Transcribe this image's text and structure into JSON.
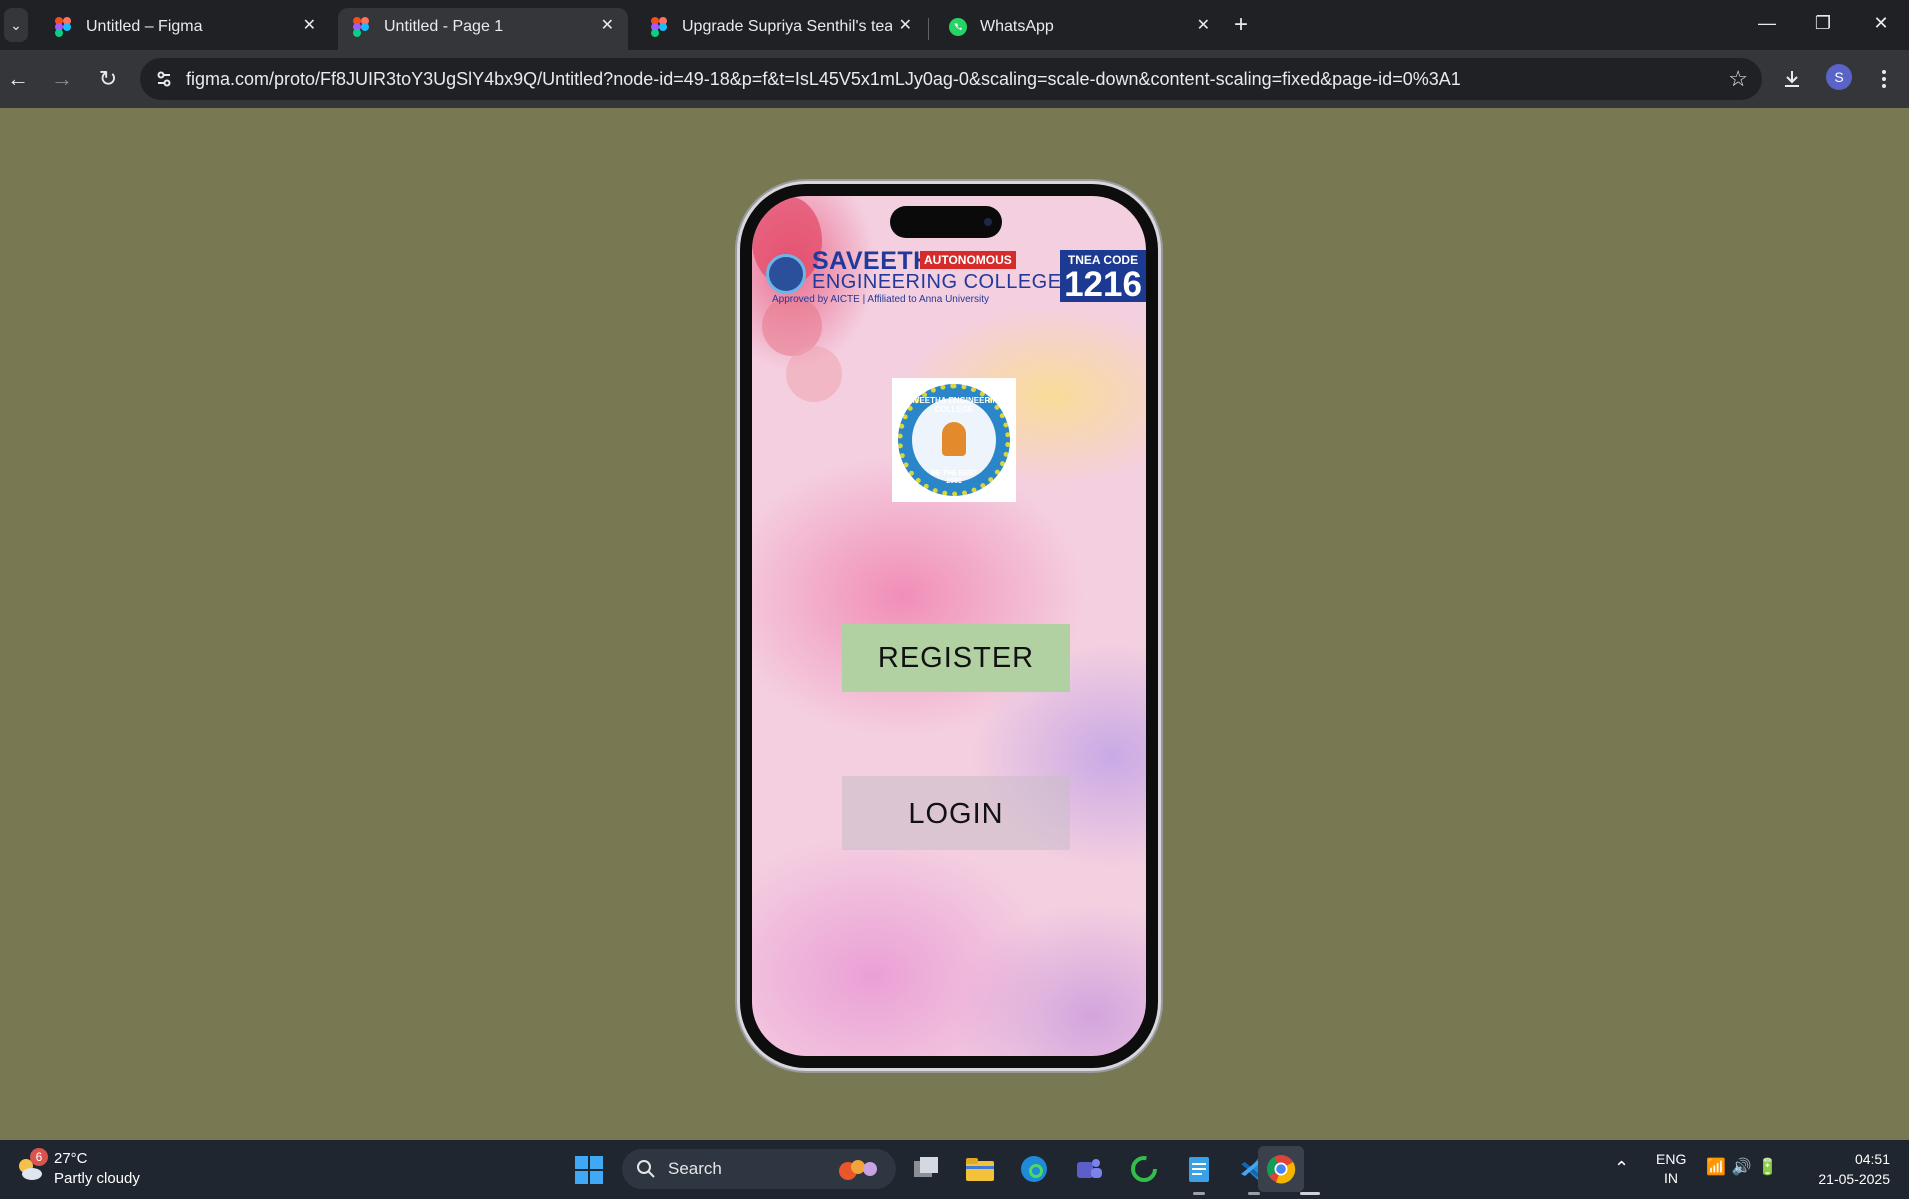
{
  "browser": {
    "tabs": [
      {
        "title": "Untitled – Figma",
        "icon": "figma-icon",
        "active": false
      },
      {
        "title": "Untitled - Page 1",
        "icon": "figma-icon",
        "active": true
      },
      {
        "title": "Upgrade Supriya Senthil's team",
        "icon": "figma-icon",
        "active": false
      },
      {
        "title": "WhatsApp",
        "icon": "whatsapp-icon",
        "active": false
      }
    ],
    "tab_close_glyph": "✕",
    "new_tab_glyph": "+",
    "url": "figma.com/proto/Ff8JUIR3toY3UgSlY4bx9Q/Untitled?node-id=49-18&p=f&t=IsL45V5x1mLJy0ag-0&scaling=scale-down&content-scaling=fixed&page-id=0%3A1",
    "profile_initial": "S"
  },
  "prototype": {
    "banner": {
      "college_name": "SAVEETHA",
      "badge": "AUTONOMOUS",
      "subtitle": "ENGINEERING COLLEGE",
      "affiliation": "Approved by AICTE | Affiliated to Anna University",
      "tnea_label": "TNEA CODE",
      "tnea_code": "1216"
    },
    "logo": {
      "top_text": "SAVEETHA ENGINEERING COLLEGE",
      "motto": "BE THE BEST",
      "year": "2001"
    },
    "register_label": "REGISTER",
    "login_label": "LOGIN"
  },
  "taskbar": {
    "weather": {
      "badge": "6",
      "temp": "27°C",
      "condition": "Partly cloudy"
    },
    "search_label": "Search",
    "apps": [
      "task-view-icon",
      "file-explorer-icon",
      "edge-icon",
      "teams-icon",
      "refresh-app-icon",
      "notepad-icon",
      "vscode-icon",
      "chrome-icon"
    ],
    "language": {
      "line1": "ENG",
      "line2": "IN"
    },
    "clock": {
      "time": "04:51",
      "date": "21-05-2025"
    }
  },
  "colors": {
    "page_background": "#787852",
    "register_button": "#b2d1a2",
    "banner_blue": "#20399a",
    "badge_red": "#d62b2b"
  }
}
